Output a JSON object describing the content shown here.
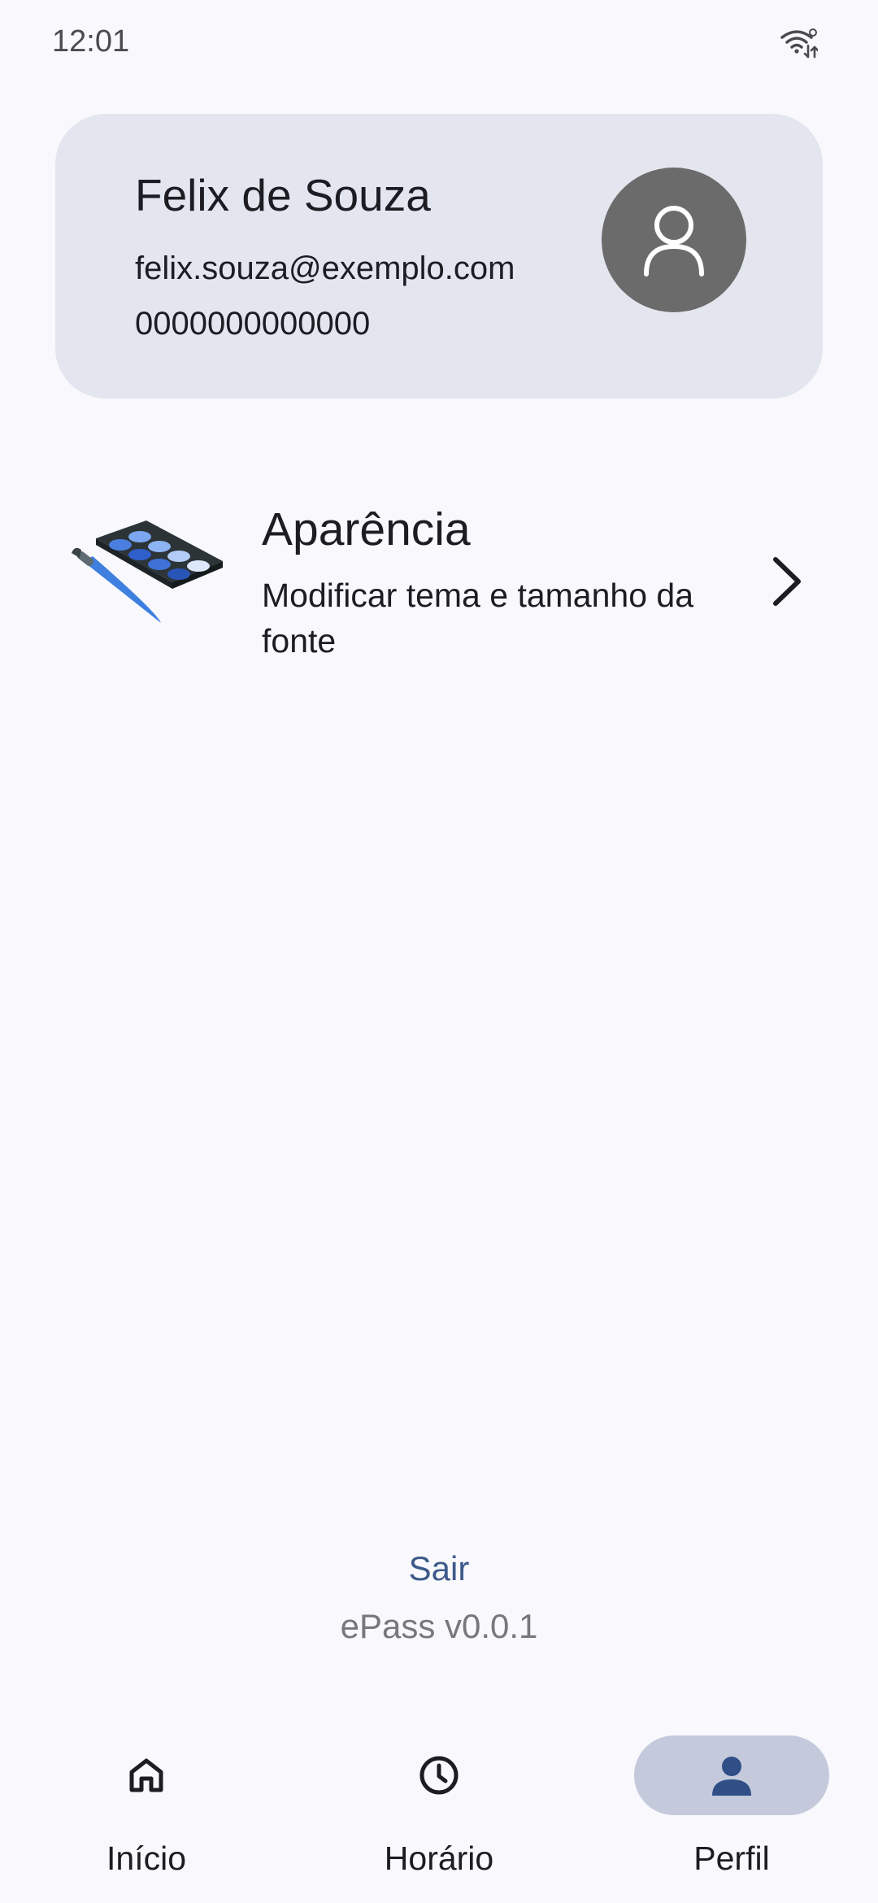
{
  "status_bar": {
    "time": "12:01",
    "icons": [
      "wifi-sync-icon"
    ]
  },
  "profile": {
    "name": "Felix de Souza",
    "email": "felix.souza@exemplo.com",
    "id": "0000000000000",
    "avatar_icon": "person-outline-icon",
    "avatar_color": "#6b6b6b"
  },
  "settings": {
    "items": [
      {
        "icon": "palette-icon",
        "title": "Aparência",
        "description": "Modificar tema e tamanho da fonte",
        "trailing_icon": "chevron-right-icon"
      }
    ]
  },
  "footer": {
    "logout_label": "Sair",
    "version": "ePass v0.0.1"
  },
  "bottom_nav": {
    "items": [
      {
        "label": "Início",
        "icon": "home-icon",
        "active": false
      },
      {
        "label": "Horário",
        "icon": "clock-icon",
        "active": false
      },
      {
        "label": "Perfil",
        "icon": "person-icon",
        "active": true
      }
    ]
  },
  "colors": {
    "background": "#f8f8fd",
    "card": "#e4e6ef",
    "accent": "#3d5a8a",
    "active_pill": "#c4cadc",
    "active_icon": "#2f4f86"
  }
}
